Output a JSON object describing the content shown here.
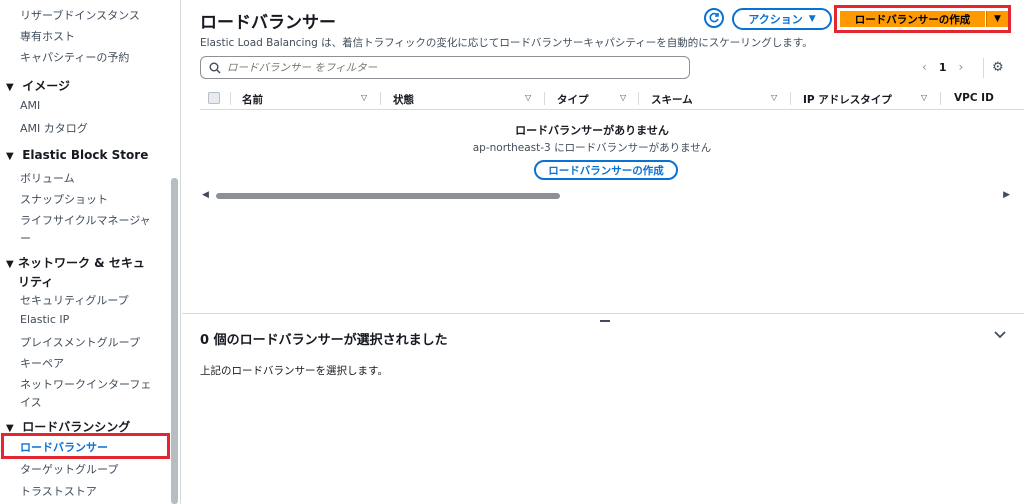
{
  "sidebar": {
    "items": [
      {
        "label": "リザーブドインスタンス"
      },
      {
        "label": "専有ホスト"
      },
      {
        "label": "キャパシティーの予約"
      }
    ],
    "sections": [
      {
        "label": "イメージ",
        "items": [
          "AMI",
          "AMI カタログ"
        ]
      },
      {
        "label": "Elastic Block Store",
        "items": [
          "ボリューム",
          "スナップショット",
          "ライフサイクルマネージャー"
        ]
      },
      {
        "label": "ネットワーク & セキュリティ",
        "items": [
          "セキュリティグループ",
          "Elastic IP",
          "プレイスメントグループ",
          "キーペア",
          "ネットワークインターフェイス"
        ]
      },
      {
        "label": "ロードバランシング",
        "items": [
          "ロードバランサー",
          "ターゲットグループ",
          "トラストストア"
        ]
      }
    ],
    "lifecycle_line1": "ライフサイクルマネージャ",
    "lifecycle_line2": "ー",
    "network_line1": "ネットワーク & セキュ",
    "network_line2": "リティ",
    "eni_line1": "ネットワークインターフェ",
    "eni_line2": "イス"
  },
  "header": {
    "title": "ロードバランサー",
    "description": "Elastic Load Balancing は、着信トラフィックの変化に応じてロードバランサーキャパシティーを自動的にスケーリングします。",
    "actions_label": "アクション",
    "create_label": "ロードバランサーの作成"
  },
  "search": {
    "placeholder": "ロードバランサー をフィルター"
  },
  "pagination": {
    "current": "1"
  },
  "table": {
    "columns": [
      "名前",
      "状態",
      "タイプ",
      "スキーム",
      "IP アドレスタイプ",
      "VPC ID"
    ],
    "empty_title": "ロードバランサーがありません",
    "empty_subtitle": "ap-northeast-3 にロードバランサーがありません",
    "empty_button": "ロードバランサーの作成"
  },
  "details": {
    "title": "0 個のロードバランサーが選択されました",
    "hint": "上記のロードバランサーを選択します。"
  },
  "colors": {
    "accent": "#0972d3",
    "primary_button": "#ff9900",
    "highlight": "#e3262f"
  }
}
